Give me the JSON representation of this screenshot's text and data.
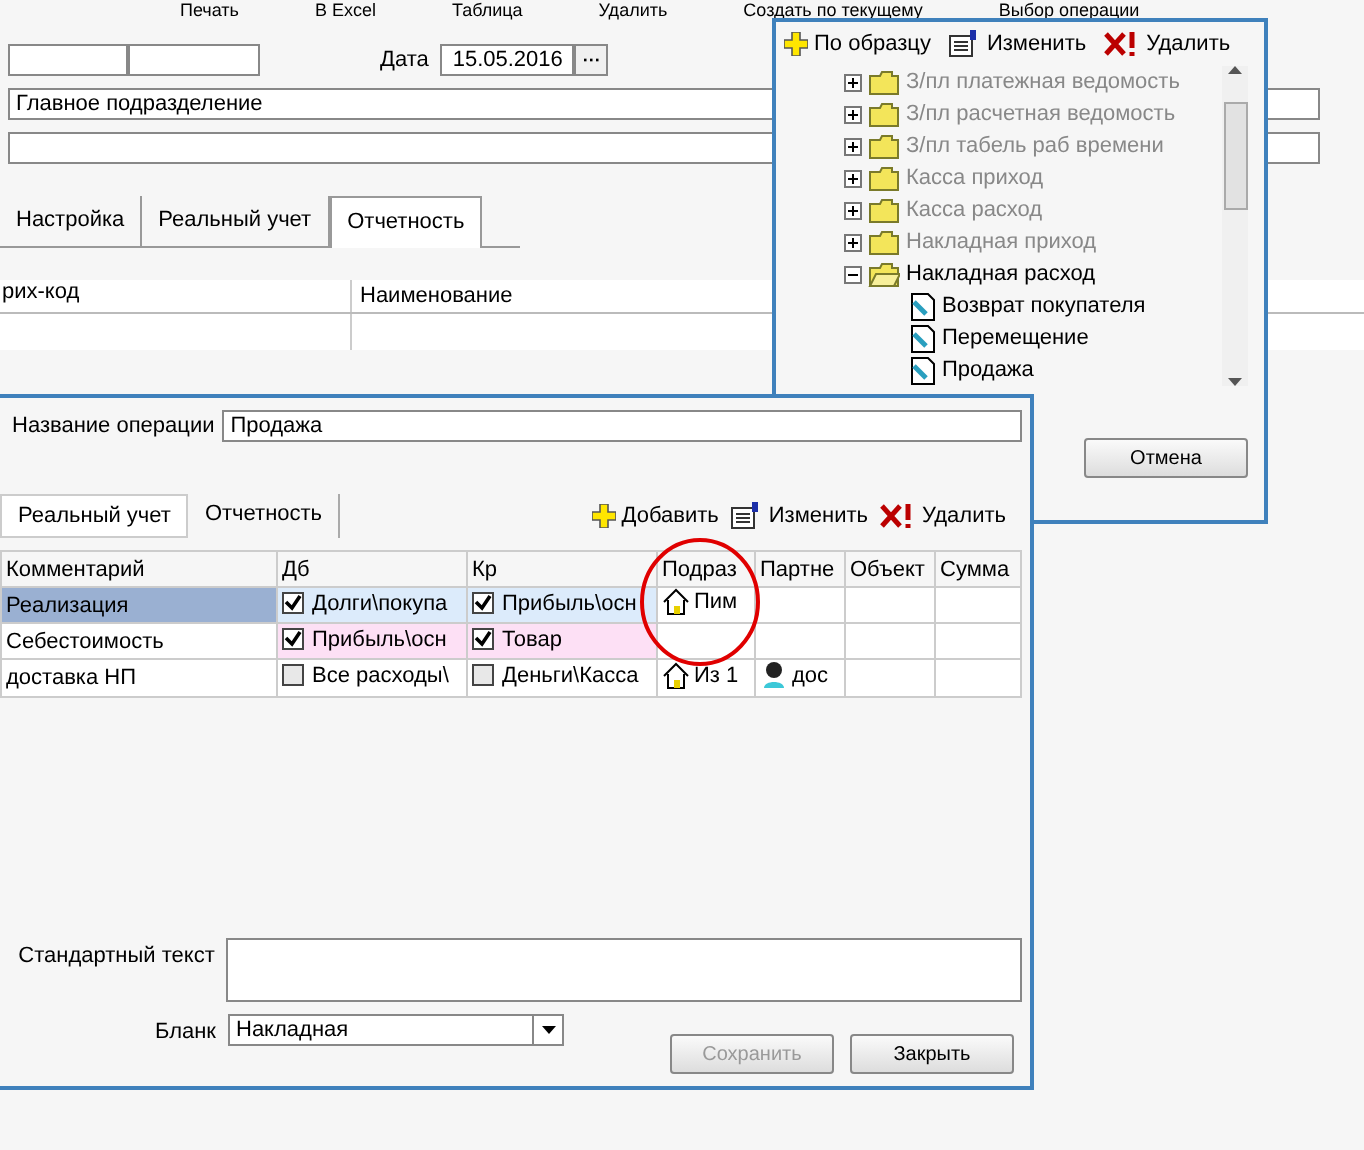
{
  "toolbar": [
    "Печать",
    "В Excel",
    "Таблица",
    "Удалить",
    "Создать по текущему",
    "Выбор операции"
  ],
  "main": {
    "date_label": "Дата",
    "date": "15.05.2016",
    "date_button": "···",
    "department": "Главное подразделение",
    "tabs": [
      {
        "label": "Настройка",
        "selected": false
      },
      {
        "label": "Реальный учет",
        "selected": false
      },
      {
        "label": "Отчетность",
        "selected": true
      }
    ],
    "columns": [
      "рих-код",
      "Наименование"
    ]
  },
  "picker": {
    "toolbar": [
      "По образцу",
      "Изменить",
      "Удалить"
    ],
    "tree": [
      {
        "label": "З/пл платежная ведомость",
        "expanded": false,
        "disabled": true
      },
      {
        "label": "З/пл расчетная ведомость",
        "expanded": false,
        "disabled": true
      },
      {
        "label": "З/пл табель раб времени",
        "expanded": false,
        "disabled": true
      },
      {
        "label": "Касса приход",
        "expanded": false,
        "disabled": true
      },
      {
        "label": "Касса расход",
        "expanded": false,
        "disabled": true
      },
      {
        "label": "Накладная приход",
        "expanded": false,
        "disabled": true
      },
      {
        "label": "Накладная расход",
        "expanded": true,
        "disabled": false,
        "children": [
          {
            "label": "Возврат покупателя"
          },
          {
            "label": "Перемещение"
          },
          {
            "label": "Продажа"
          }
        ]
      }
    ],
    "cancel": "Отмена"
  },
  "dialog": {
    "name_label": "Название операции",
    "name": "Продажа",
    "tabs": [
      {
        "label": "Реальный учет",
        "selected": true
      },
      {
        "label": "Отчетность",
        "selected": false
      }
    ],
    "toolbar": [
      "Добавить",
      "Изменить",
      "Удалить"
    ],
    "columns": [
      "Комментарий",
      "Дб",
      "Кр",
      "Подраз",
      "Партне",
      "Объект",
      "Сумма"
    ],
    "rows": [
      {
        "comment": "Реализация",
        "selected": true,
        "db": {
          "text": "Долги\\покупа",
          "checked": true,
          "color": "#dcebfb"
        },
        "kr": {
          "text": "Прибыль\\осн",
          "checked": true,
          "color": "#dcebfb"
        },
        "dept": "Пим",
        "partner": ""
      },
      {
        "comment": "Себестоимость",
        "selected": false,
        "db": {
          "text": "Прибыль\\осн",
          "checked": true,
          "color": "#fde0f5"
        },
        "kr": {
          "text": "Товар",
          "checked": true,
          "color": "#fde0f5"
        },
        "dept": "",
        "partner": ""
      },
      {
        "comment": "доставка НП",
        "selected": false,
        "db": {
          "text": "Все расходы\\",
          "checked": false,
          "color": "#ffffff"
        },
        "kr": {
          "text": "Деньги\\Касса",
          "checked": false,
          "color": "#ffffff"
        },
        "dept": "Из 1",
        "partner": "дос"
      }
    ],
    "text_label": "Стандартный текст",
    "blank_label": "Бланк",
    "blank": "Накладная",
    "save": {
      "label": "Сохранить",
      "disabled": true
    },
    "close": "Закрыть"
  }
}
